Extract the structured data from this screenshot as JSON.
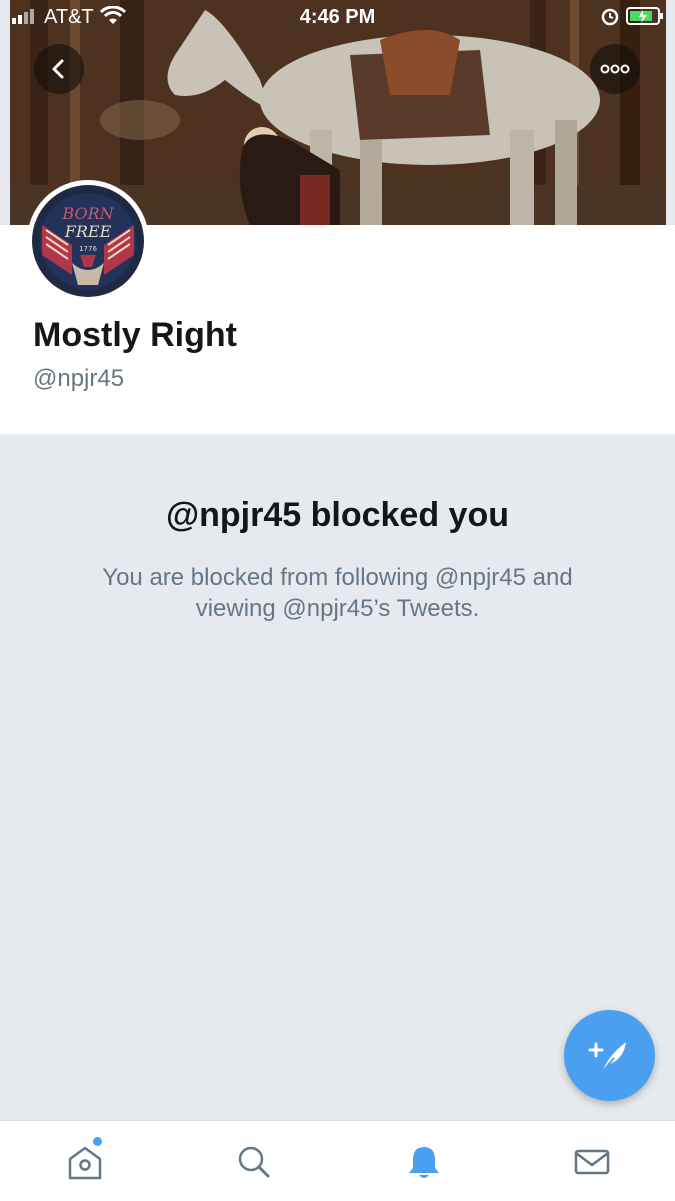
{
  "status_bar": {
    "carrier": "AT&T",
    "time": "4:46 PM"
  },
  "profile": {
    "display_name": "Mostly Right",
    "handle": "@npjr45",
    "avatar_text_top": "BORN",
    "avatar_text_mid": "FREE",
    "avatar_text_year": "1776"
  },
  "blocked": {
    "title": "@npjr45 blocked you",
    "message": "You are blocked from following @npjr45 and viewing @npjr45’s Tweets."
  },
  "colors": {
    "accent": "#4a9ff0",
    "page_background": "#e6e9ee",
    "secondary_text": "#657786"
  },
  "tabs": [
    {
      "icon": "home-icon",
      "has_badge": true
    },
    {
      "icon": "search-icon"
    },
    {
      "icon": "bell-icon",
      "active": true
    },
    {
      "icon": "mail-icon"
    }
  ]
}
